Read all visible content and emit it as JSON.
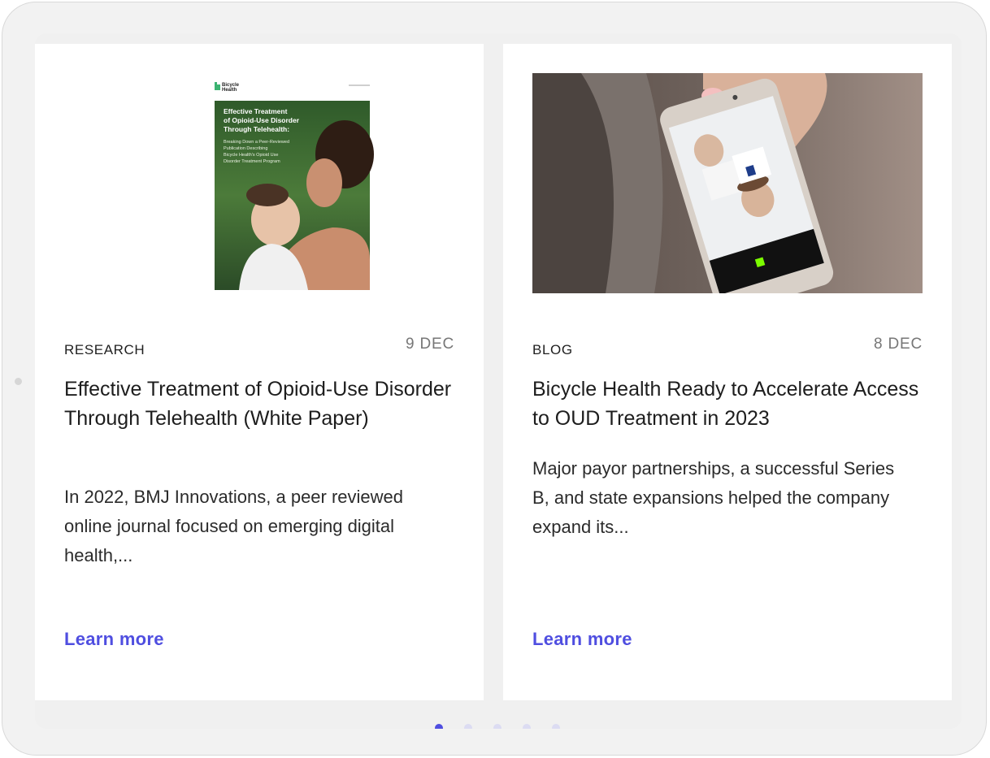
{
  "cards": [
    {
      "category": "RESEARCH",
      "date": "9 DEC",
      "title": "Effective Treatment of Opioid-Use Disorder Through Telehealth (White Paper)",
      "excerpt": "In 2022, BMJ Innovations, a peer reviewed online journal focused on emerging digital health,...",
      "link_label": "Learn more",
      "image": {
        "logo_text_line1": "Bicycle",
        "logo_text_line2": "Health",
        "cover_title": "Effective Treatment of Opioid-Use Disorder Through Telehealth:",
        "cover_subtitle": "Breaking Down a Peer-Reviewed Publication Describing Bicycle Health's Opioid Use Disorder Treatment Program"
      }
    },
    {
      "category": "BLOG",
      "date": "8 DEC",
      "title": "Bicycle Health Ready to Accelerate Access to OUD Treatment in 2023",
      "excerpt": "Major payor partnerships, a successful Series B, and state expansions helped the company expand its...",
      "link_label": "Learn more",
      "image": {
        "icon": "phone-video-call-photo"
      }
    }
  ],
  "pagination": {
    "count": 5,
    "active": 0
  },
  "colors": {
    "accent": "#4f4ee0",
    "dot_inactive": "#dcdcf2",
    "card_bg": "#ffffff",
    "frame_bg": "#f2f2f2"
  }
}
